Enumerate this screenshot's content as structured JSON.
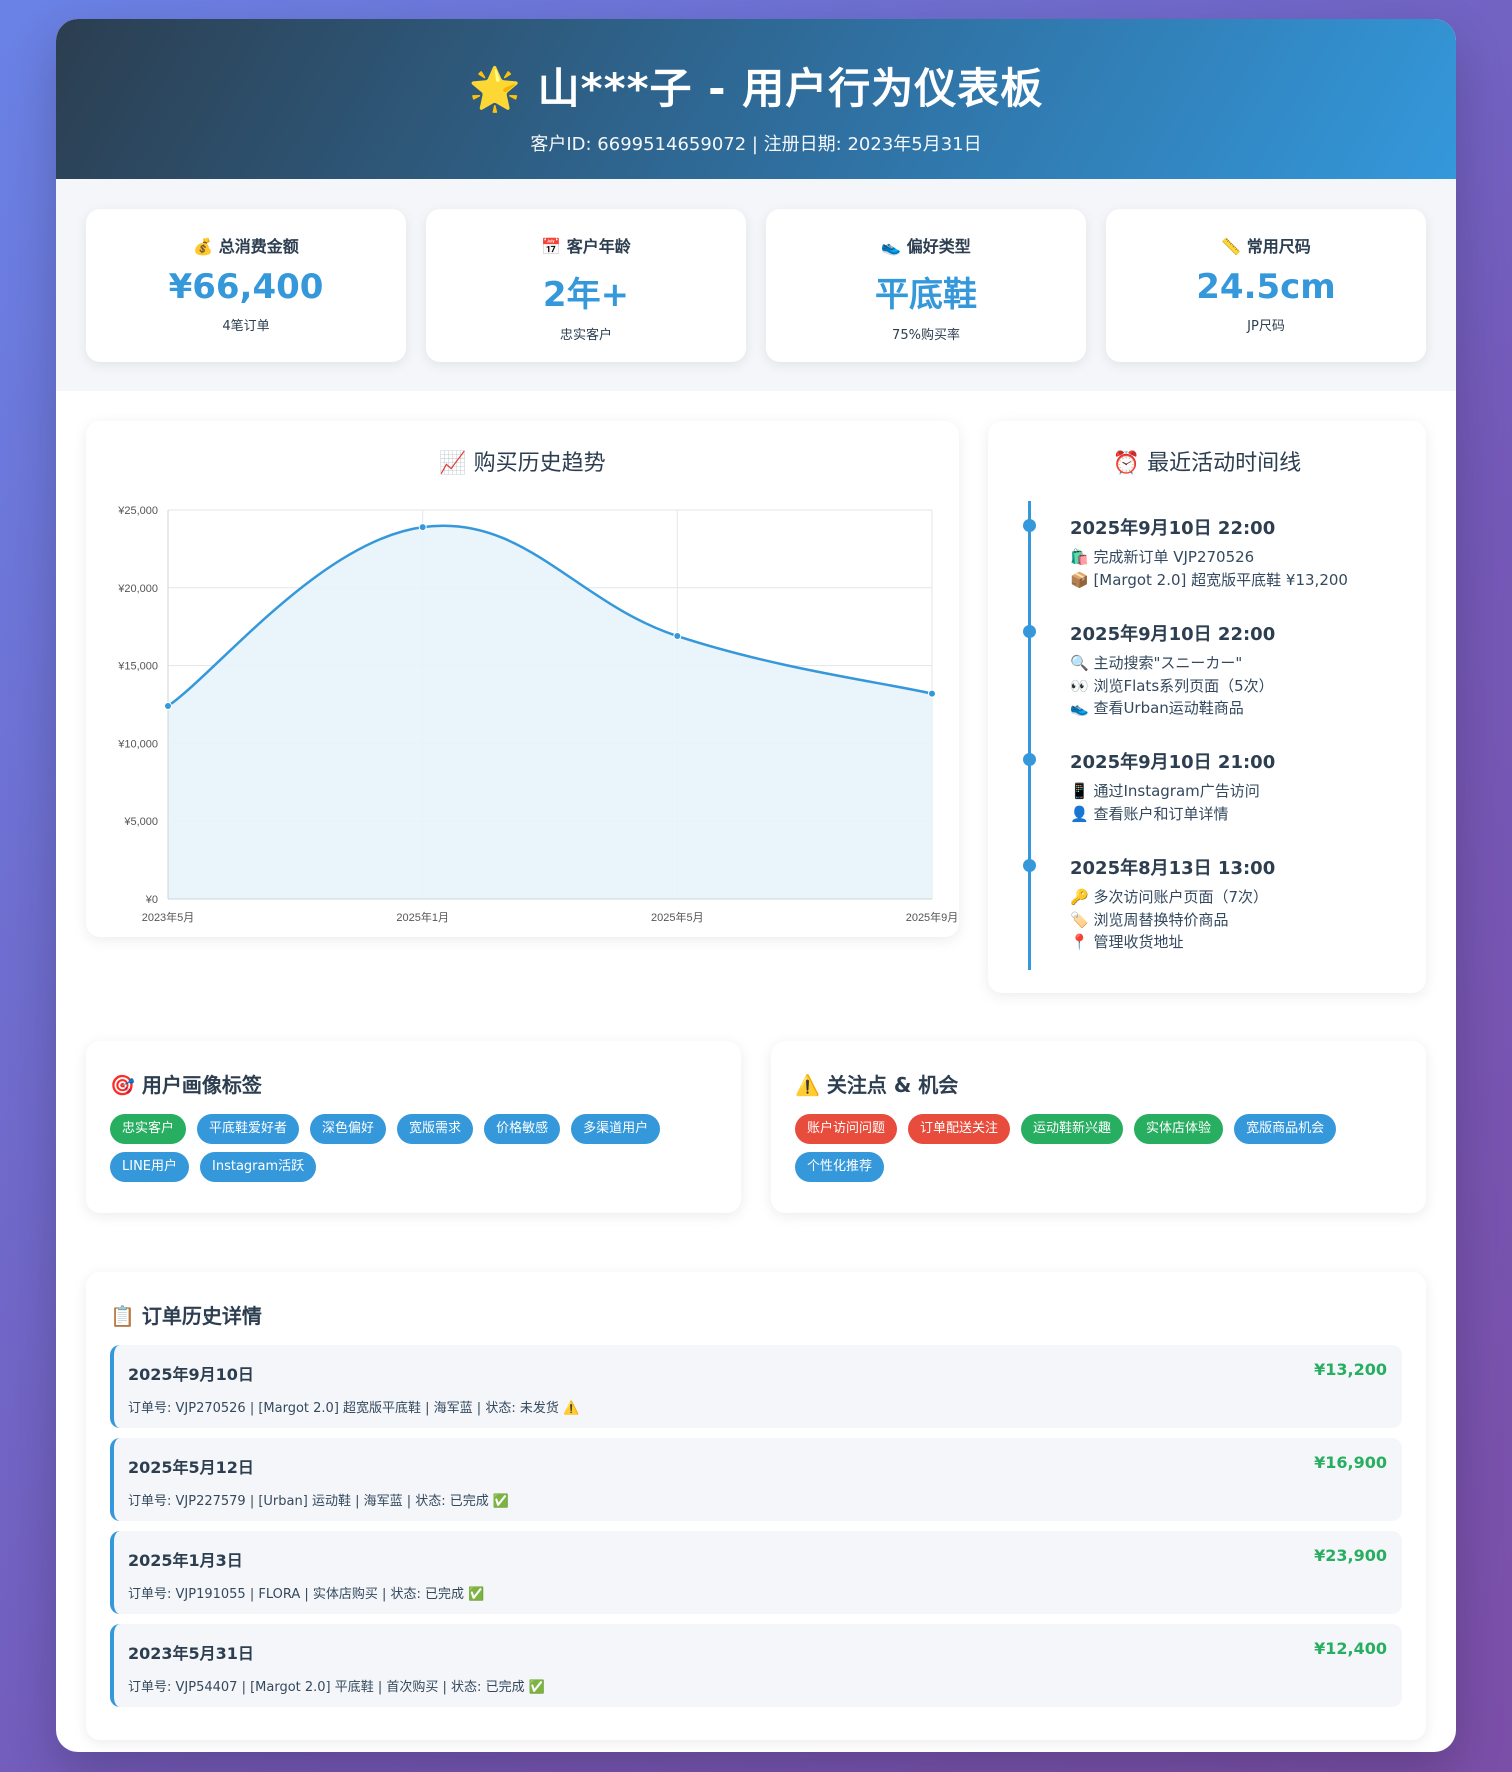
{
  "header": {
    "icon": "star",
    "title": "🌟 山***子 - 用户行为仪表板",
    "subtitle": "客户ID: 6699514659072 | 注册日期: 2023年5月31日"
  },
  "stats": [
    {
      "label": "💰 总消费金额",
      "value": "¥66,400",
      "note": "4笔订单"
    },
    {
      "label": "📅 客户年龄",
      "value": "2年+",
      "note": "忠实客户"
    },
    {
      "label": "👟 偏好类型",
      "value": "平底鞋",
      "note": "75%购买率"
    },
    {
      "label": "📏 常用尺码",
      "value": "24.5cm",
      "note": "JP尺码"
    }
  ],
  "chart": {
    "title": "📈 购买历史趋势"
  },
  "chart_data": {
    "type": "area",
    "categories": [
      "2023年5月",
      "2025年1月",
      "2025年5月",
      "2025年9月"
    ],
    "values": [
      12400,
      23900,
      16900,
      13200
    ],
    "ylim": [
      0,
      25000
    ],
    "yticks": [
      "¥0",
      "¥5,000",
      "¥10,000",
      "¥15,000",
      "¥20,000",
      "¥25,000"
    ],
    "line_color": "#3498db",
    "fill_color": "#e8f3fb",
    "grid": true
  },
  "timeline": {
    "title": "⏰ 最近活动时间线",
    "items": [
      {
        "time": "2025年9月10日 22:00",
        "lines": [
          "🛍️ 完成新订单 VJP270526",
          "📦 [Margot 2.0] 超宽版平底鞋 ¥13,200"
        ]
      },
      {
        "time": "2025年9月10日 22:00",
        "lines": [
          "🔍 主动搜索\"スニーカー\"",
          "👀 浏览Flats系列页面（5次）",
          "👟 查看Urban运动鞋商品"
        ]
      },
      {
        "time": "2025年9月10日 21:00",
        "lines": [
          "📱 通过Instagram广告访问",
          "👤 查看账户和订单详情"
        ]
      },
      {
        "time": "2025年8月13日 13:00",
        "lines": [
          "🔑 多次访问账户页面（7次）",
          "🏷️ 浏览周替换特价商品",
          "📍 管理收货地址"
        ]
      }
    ]
  },
  "profile_tags": {
    "title": "🎯 用户画像标签",
    "tags": [
      {
        "text": "忠实客户",
        "color": "green"
      },
      {
        "text": "平底鞋爱好者",
        "color": "blue"
      },
      {
        "text": "深色偏好",
        "color": "blue"
      },
      {
        "text": "宽版需求",
        "color": "blue"
      },
      {
        "text": "价格敏感",
        "color": "blue"
      },
      {
        "text": "多渠道用户",
        "color": "blue"
      },
      {
        "text": "LINE用户",
        "color": "blue"
      },
      {
        "text": "Instagram活跃",
        "color": "blue"
      }
    ]
  },
  "concerns": {
    "title": "⚠️ 关注点 & 机会",
    "tags": [
      {
        "text": "账户访问问题",
        "color": "red"
      },
      {
        "text": "订单配送关注",
        "color": "red"
      },
      {
        "text": "运动鞋新兴趣",
        "color": "green"
      },
      {
        "text": "实体店体验",
        "color": "green"
      },
      {
        "text": "宽版商品机会",
        "color": "blue"
      },
      {
        "text": "个性化推荐",
        "color": "blue"
      }
    ]
  },
  "orders": {
    "title": "📋 订单历史详情",
    "items": [
      {
        "date": "2025年9月10日",
        "detail": "订单号: VJP270526 | [Margot 2.0] 超宽版平底鞋 | 海军蓝 | 状态: 未发货 ⚠️",
        "amount": "¥13,200"
      },
      {
        "date": "2025年5月12日",
        "detail": "订单号: VJP227579 | [Urban] 运动鞋 | 海军蓝 | 状态: 已完成 ✅",
        "amount": "¥16,900"
      },
      {
        "date": "2025年1月3日",
        "detail": "订单号: VJP191055 | FLORA | 实体店购买 | 状态: 已完成 ✅",
        "amount": "¥23,900"
      },
      {
        "date": "2023年5月31日",
        "detail": "订单号: VJP54407 | [Margot 2.0] 平底鞋 | 首次购买 | 状态: 已完成 ✅",
        "amount": "¥12,400"
      }
    ]
  }
}
